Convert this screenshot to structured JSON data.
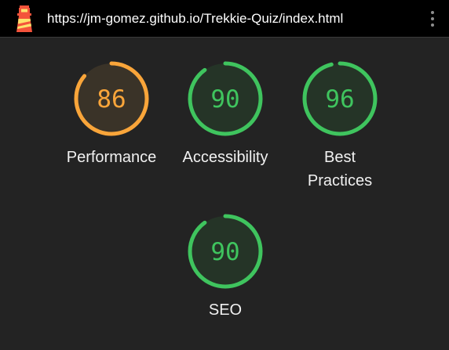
{
  "header": {
    "url": "https://jm-gomez.github.io/Trekkie-Quiz/index.html",
    "logo_icon": "lighthouse-icon",
    "menu_icon": "kebab-menu-icon"
  },
  "colors": {
    "average": "#f9a53a",
    "pass": "#3fc45e",
    "track_average": "#3a3328",
    "track_pass": "#253427"
  },
  "gauges": [
    {
      "id": "performance",
      "label": "Performance",
      "score": 86,
      "rating": "average"
    },
    {
      "id": "accessibility",
      "label": "Accessibility",
      "score": 90,
      "rating": "pass"
    },
    {
      "id": "best-practices",
      "label": "Best Practices",
      "score": 96,
      "rating": "pass"
    },
    {
      "id": "seo",
      "label": "SEO",
      "score": 90,
      "rating": "pass"
    }
  ]
}
